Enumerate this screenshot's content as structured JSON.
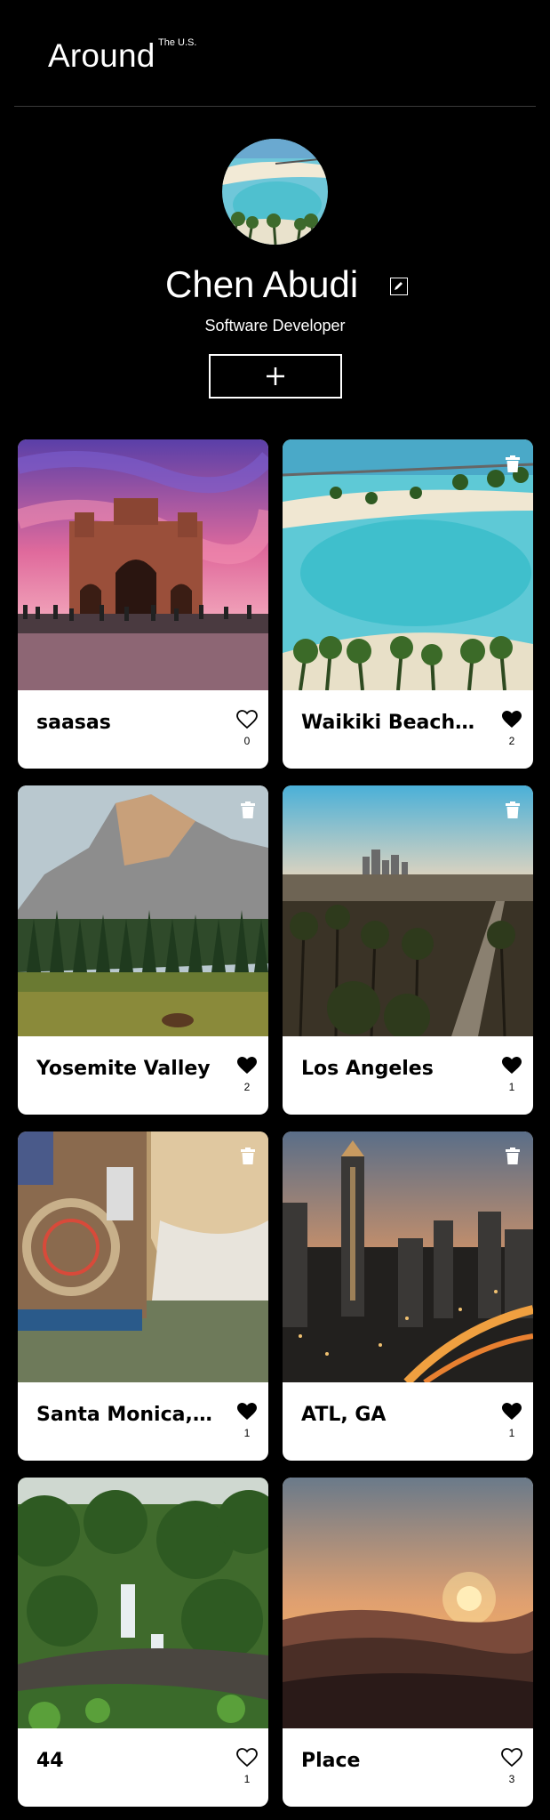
{
  "header": {
    "logo": "Around",
    "logo_sup": "The U.S."
  },
  "profile": {
    "name": "Chen Abudi",
    "job": "Software Developer",
    "avatar_icon": "avatar-photo",
    "edit_icon": "pencil-icon",
    "add_icon": "plus-icon"
  },
  "cards": [
    {
      "title": "saasas",
      "likes": "0",
      "liked": false,
      "deletable": false
    },
    {
      "title": "Waikiki Beach, Honolulu",
      "likes": "2",
      "liked": true,
      "deletable": true
    },
    {
      "title": "Yosemite Valley",
      "likes": "2",
      "liked": true,
      "deletable": true
    },
    {
      "title": "Los Angeles",
      "likes": "1",
      "liked": true,
      "deletable": true
    },
    {
      "title": "Santa Monica, CA",
      "likes": "1",
      "liked": true,
      "deletable": true
    },
    {
      "title": "ATL, GA",
      "likes": "1",
      "liked": true,
      "deletable": true
    },
    {
      "title": "44",
      "likes": "1",
      "liked": false,
      "deletable": false
    },
    {
      "title": "Place",
      "likes": "3",
      "liked": false,
      "deletable": false
    }
  ],
  "colors": {
    "background": "#000000",
    "card": "#ffffff",
    "text_dark": "#000000",
    "text_light": "#ffffff"
  }
}
